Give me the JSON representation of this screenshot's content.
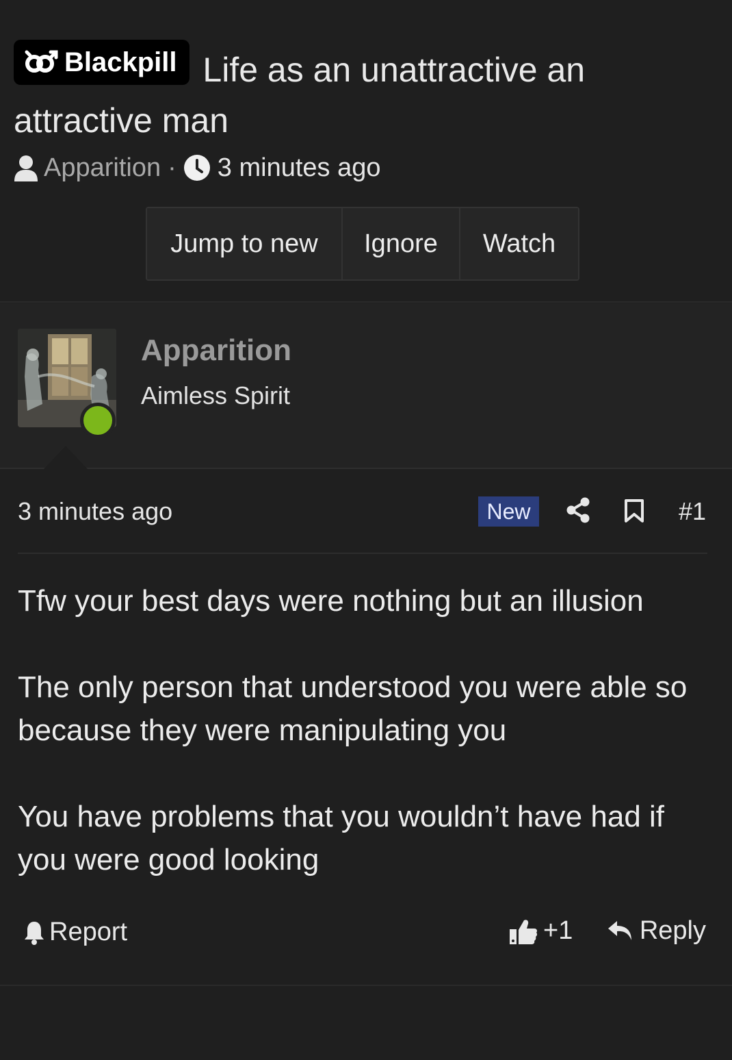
{
  "thread": {
    "prefix": "Blackpill",
    "title": "Life as an unattractive an attractive man",
    "author": "Apparition",
    "separator": "·",
    "time": "3 minutes ago"
  },
  "actions": {
    "jump_to_new": "Jump to new",
    "ignore": "Ignore",
    "watch": "Watch"
  },
  "post": {
    "user_name": "Apparition",
    "user_title": "Aimless Spirit",
    "online_color": "#7cb71b",
    "time": "3 minutes ago",
    "new_badge": "New",
    "post_number": "#1",
    "body": [
      "Tfw your best days were nothing but an illusion",
      "The only person that understood you were able so because they were manipulating you",
      "You have problems that you wouldn’t have had if you were good looking"
    ],
    "report_label": "Report",
    "reaction_count": "+1",
    "reply_label": "Reply"
  }
}
